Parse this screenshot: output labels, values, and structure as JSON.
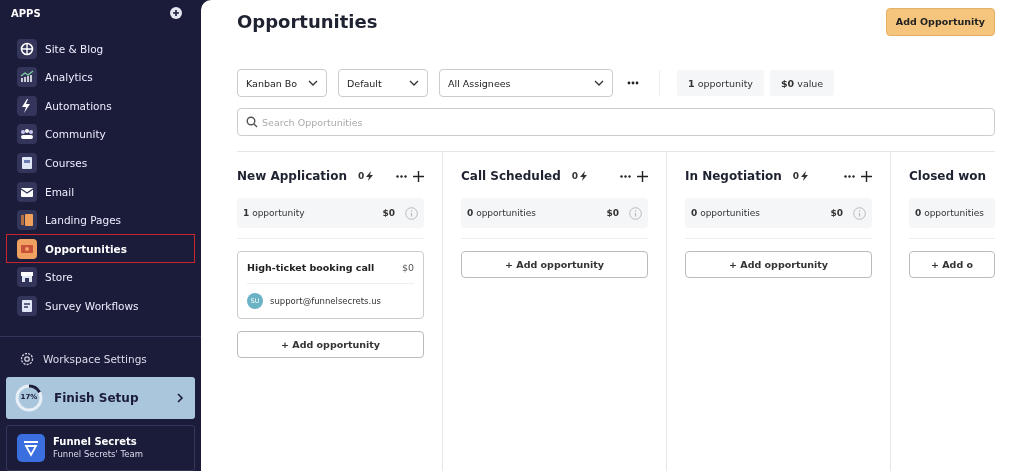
{
  "sidebar": {
    "section_title": "APPS",
    "items": [
      {
        "label": "Site & Blog",
        "selected": false
      },
      {
        "label": "Analytics",
        "selected": false
      },
      {
        "label": "Automations",
        "selected": false
      },
      {
        "label": "Community",
        "selected": false
      },
      {
        "label": "Courses",
        "selected": false
      },
      {
        "label": "Email",
        "selected": false
      },
      {
        "label": "Landing Pages",
        "selected": false
      },
      {
        "label": "Opportunities",
        "selected": true
      },
      {
        "label": "Store",
        "selected": false
      },
      {
        "label": "Survey Workflows",
        "selected": false
      }
    ],
    "settings": "Workspace Settings",
    "setup": {
      "percent": "17%",
      "level": 0.17,
      "label": "Finish Setup"
    },
    "workspace": {
      "name": "Funnel Secrets",
      "team": "Funnel Secrets' Team"
    }
  },
  "page": {
    "title": "Opportunities",
    "add_button": "Add Opportunity",
    "filters": [
      "Kanban Bo",
      "Default",
      "All Assignees"
    ],
    "stats": [
      "**1** opportunity",
      "**$0** value"
    ],
    "search": {
      "placeholder": "Search Opportunities"
    }
  },
  "columns": [
    {
      "name": "New Application",
      "count": "0",
      "summary": "**1** opportunity",
      "total": "$0",
      "cards": [
        {
          "title": "High-ticket booking call",
          "value": "$0",
          "avatar": "SU",
          "email": "support@funnelsecrets.us"
        }
      ],
      "add": "+ Add opportunity"
    },
    {
      "name": "Call Scheduled",
      "count": "0",
      "summary": "**0** opportunities",
      "total": "$0",
      "add": "+ Add opportunity"
    },
    {
      "name": "In Negotiation",
      "count": "0",
      "summary": "**0** opportunities",
      "total": "$0",
      "add": "+ Add opportunity"
    },
    {
      "name": "Closed won",
      "summary": "**0** opportunities",
      "add": "+ Add o"
    }
  ]
}
